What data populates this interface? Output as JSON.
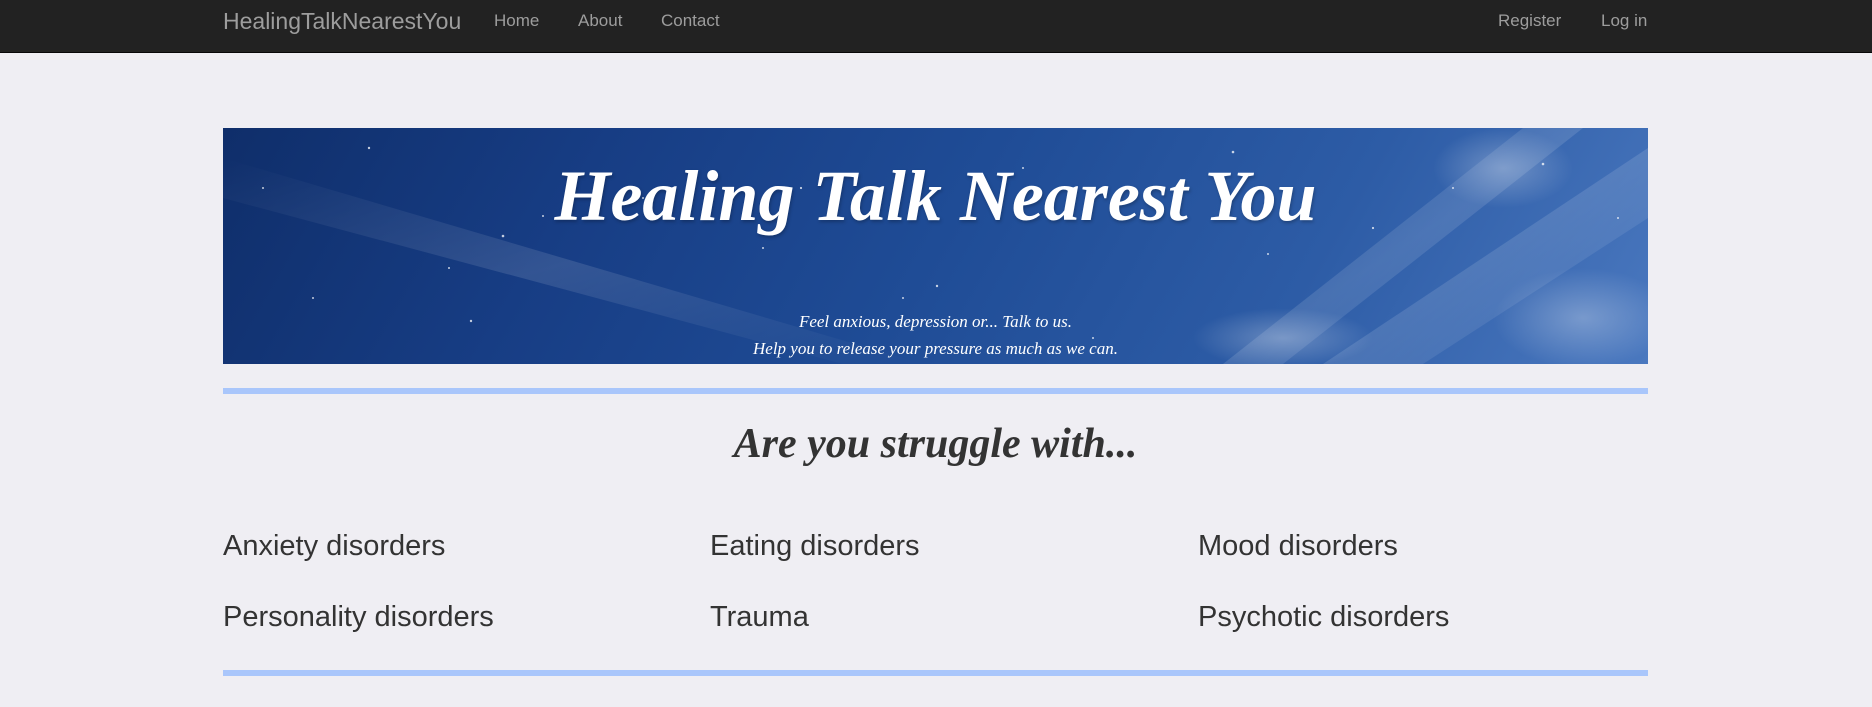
{
  "navbar": {
    "brand": "HealingTalkNearestYou",
    "links": [
      "Home",
      "About",
      "Contact"
    ],
    "auth": {
      "register": "Register",
      "login": "Log in"
    }
  },
  "banner": {
    "title": "Healing Talk Nearest You",
    "subtitle_line1": "Feel anxious, depression or... Talk to us.",
    "subtitle_line2": "Help you to release your pressure as much as we can."
  },
  "section": {
    "title": "Are you struggle with...",
    "disorders": [
      "Anxiety disorders",
      "Eating disorders",
      "Mood disorders",
      "Personality disorders",
      "Trauma",
      "Psychotic disorders"
    ]
  },
  "colors": {
    "navbar_bg": "#222222",
    "nav_text": "#9d9d9d",
    "page_bg": "#efeef3",
    "rule": "#a9c6fb",
    "banner_sky": "#1f4c96"
  }
}
